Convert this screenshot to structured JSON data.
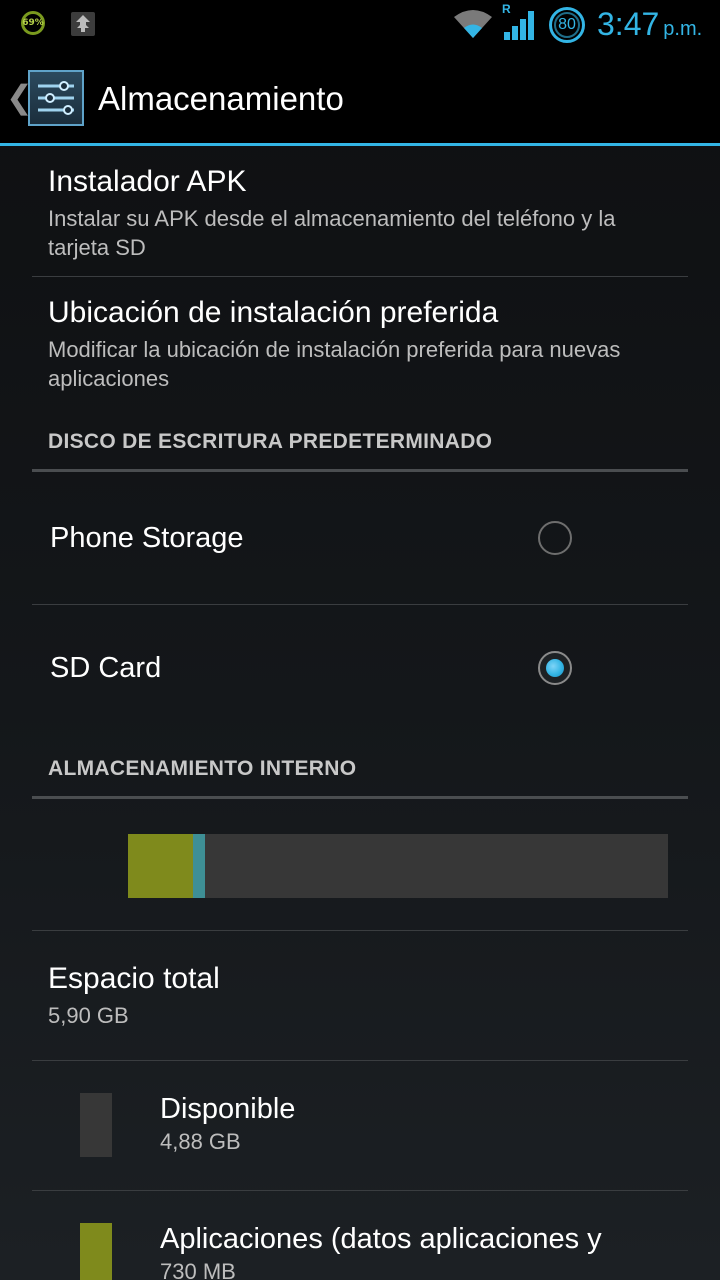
{
  "status_bar": {
    "battery_widget_label": "69%",
    "roaming_indicator": "R",
    "battery_level": "80",
    "clock_time": "3:47",
    "clock_ampm": "p.m.",
    "accent_color": "#33b5e5",
    "icons": [
      "battery-widget-icon",
      "upload-icon",
      "wifi-icon",
      "signal-icon",
      "battery-circle-icon"
    ]
  },
  "action_bar": {
    "title": "Almacenamiento",
    "back_icon": "chevron-left-icon",
    "app_icon": "settings-sliders-icon"
  },
  "preferences": [
    {
      "title": "Instalador APK",
      "summary": "Instalar su APK desde el almacenamiento del teléfono y la tarjeta SD"
    },
    {
      "title": "Ubicación de instalación preferida",
      "summary": "Modificar la ubicación de instalación preferida para nuevas aplicaciones"
    }
  ],
  "default_write_disk": {
    "header": "DISCO DE ESCRITURA PREDETERMINADO",
    "options": [
      {
        "label": "Phone Storage",
        "checked": false
      },
      {
        "label": "SD Card",
        "checked": true
      }
    ]
  },
  "internal_storage": {
    "header": "ALMACENAMIENTO INTERNO",
    "usage_bar": {
      "segments": [
        {
          "name": "apps",
          "fraction": 0.12,
          "color": "#7f8a1c"
        },
        {
          "name": "other",
          "fraction": 0.022,
          "color": "#3e8f95"
        }
      ],
      "free_color": "#373737"
    },
    "total": {
      "title": "Espacio total",
      "value": "5,90 GB"
    },
    "legend": [
      {
        "title": "Disponible",
        "value": "4,88 GB",
        "color": "#373737"
      },
      {
        "title": "Aplicaciones (datos aplicaciones y",
        "value": "730 MB",
        "color": "#7f8a1c"
      }
    ]
  }
}
